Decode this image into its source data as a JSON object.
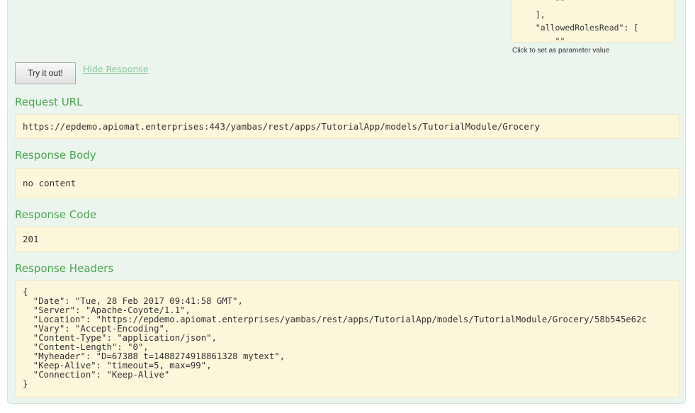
{
  "model_preview": {
    "lines": [
      "      \"\"",
      "  ],",
      "  \"allowedRolesRead\": [",
      "      \"\""
    ],
    "hint": "Click to set as parameter value"
  },
  "actions": {
    "try_label": "Try it out!",
    "hide_label": "Hide Response"
  },
  "request_url": {
    "title": "Request URL",
    "value": "https://epdemo.apiomat.enterprises:443/yambas/rest/apps/TutorialApp/models/TutorialModule/Grocery"
  },
  "response_body": {
    "title": "Response Body",
    "value": "no content"
  },
  "response_code": {
    "title": "Response Code",
    "value": "201"
  },
  "response_headers": {
    "title": "Response Headers",
    "text": "{\n  \"Date\": \"Tue, 28 Feb 2017 09:41:58 GMT\",\n  \"Server\": \"Apache-Coyote/1.1\",\n  \"Location\": \"https://epdemo.apiomat.enterprises/yambas/rest/apps/TutorialApp/models/TutorialModule/Grocery/58b545e62c\n  \"Vary\": \"Accept-Encoding\",\n  \"Content-Type\": \"application/json\",\n  \"Content-Length\": \"0\",\n  \"Myheader\": \"D=67388 t=1488274918861328 mytext\",\n  \"Keep-Alive\": \"timeout=5, max=99\",\n  \"Connection\": \"Keep-Alive\"\n}"
  }
}
